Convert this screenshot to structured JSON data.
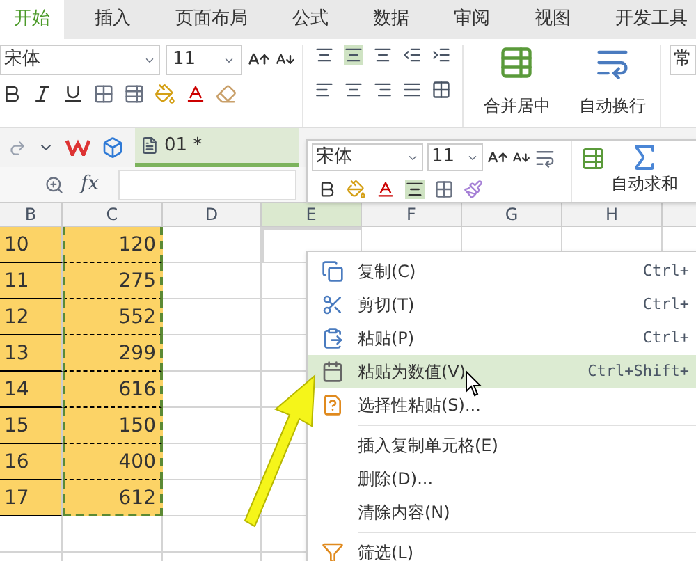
{
  "ribbon_tabs": [
    {
      "label": "开始",
      "selected": true
    },
    {
      "label": "插入",
      "selected": false
    },
    {
      "label": "页面布局",
      "selected": false
    },
    {
      "label": "公式",
      "selected": false
    },
    {
      "label": "数据",
      "selected": false
    },
    {
      "label": "审阅",
      "selected": false
    },
    {
      "label": "视图",
      "selected": false
    },
    {
      "label": "开发工具",
      "selected": false
    }
  ],
  "ribbon": {
    "font_name": "宋体",
    "font_size": "11",
    "merge_button": "合并居中",
    "wrap_button": "自动换行",
    "cut_label": "常"
  },
  "document_tab": {
    "title": "01 *"
  },
  "formula_bar": {
    "function_label": "fx"
  },
  "mini_toolbar": {
    "font_name": "宋体",
    "font_size": "11",
    "autosum_button": "自动求和"
  },
  "columns": [
    {
      "label": "B",
      "selected": false
    },
    {
      "label": "C",
      "selected": false
    },
    {
      "label": "D",
      "selected": false
    },
    {
      "label": "E",
      "selected": true
    },
    {
      "label": "F",
      "selected": false
    },
    {
      "label": "G",
      "selected": false
    },
    {
      "label": "H",
      "selected": false
    }
  ],
  "rows": [
    {
      "b": "10",
      "c": "120"
    },
    {
      "b": "11",
      "c": "275"
    },
    {
      "b": "12",
      "c": "552"
    },
    {
      "b": "13",
      "c": "299"
    },
    {
      "b": "14",
      "c": "616"
    },
    {
      "b": "15",
      "c": "150"
    },
    {
      "b": "16",
      "c": "400"
    },
    {
      "b": "17",
      "c": "612"
    }
  ],
  "context_menu": {
    "items": [
      {
        "kind": "copy",
        "label": "复制(C)",
        "shortcut": "Ctrl+",
        "selected": false
      },
      {
        "kind": "cut",
        "label": "剪切(T)",
        "shortcut": "Ctrl+",
        "selected": false
      },
      {
        "kind": "paste",
        "label": "粘贴(P)",
        "shortcut": "Ctrl+",
        "selected": false
      },
      {
        "kind": "paste_values",
        "label": "粘贴为数值(V)",
        "shortcut": "Ctrl+Shift+",
        "selected": true
      },
      {
        "kind": "paste_special",
        "label": "选择性粘贴(S)...",
        "selected": false
      },
      {
        "kind": "divider"
      },
      {
        "kind": "plain",
        "label": "插入复制单元格(E)",
        "selected": false
      },
      {
        "kind": "plain",
        "label": "删除(D)...",
        "selected": false
      },
      {
        "kind": "plain",
        "label": "清除内容(N)",
        "selected": false
      },
      {
        "kind": "divider"
      },
      {
        "kind": "filter",
        "label": "筛选(L)",
        "selected": false
      }
    ]
  }
}
